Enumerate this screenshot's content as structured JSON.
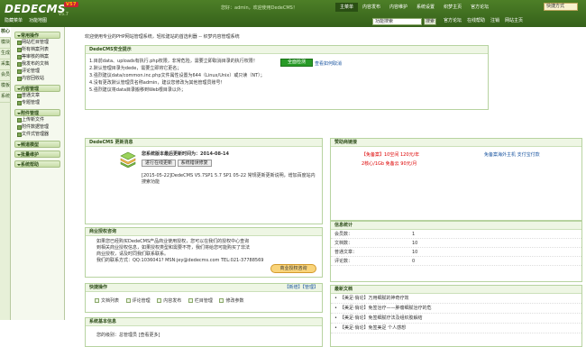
{
  "top": {
    "logo": "DEDECMS",
    "version_badge": "V57",
    "version_sub": "v5.7",
    "welcome": "您好：admin，欢迎使用DedeCMS！",
    "nav": [
      "主菜单",
      "内容发布",
      "内容维护",
      "系统设置",
      "织梦主页",
      "官方论坛"
    ],
    "active_nav": 0,
    "lang_label": "快捷方式"
  },
  "subbar": {
    "hide_label": "隐藏菜单",
    "func_label": "功能地图"
  },
  "search": {
    "value": "功能搜索",
    "button": "搜索"
  },
  "quick": [
    "官方论坛",
    "在线帮助",
    "注销",
    "网站主页"
  ],
  "sidetabs": [
    "核心",
    "模块",
    "生成",
    "采集",
    "会员",
    "模板",
    "系统"
  ],
  "menu": [
    {
      "title": "常用操作",
      "items": [
        "网站栏目管理",
        "所有档案列表",
        "等审核的档案",
        "我发布的文档",
        "评论管理",
        "内容回收站"
      ]
    },
    {
      "title": "内容管理",
      "items": [
        "普通文章",
        "专题管理"
      ]
    },
    {
      "title": "附件管理",
      "items": [
        "上传新文件",
        "附件数据管理",
        "文件式管理器"
      ]
    },
    {
      "title": "频道模型",
      "items": []
    },
    {
      "title": "批量维护",
      "items": []
    },
    {
      "title": "系统帮助",
      "items": []
    }
  ],
  "main": {
    "crumb": "欢迎使用专业的PHP网站管理系统，轻松建站的首选利器 -- 织梦内容管理系统",
    "security": {
      "title": "DedeCMS安全提示",
      "lines": [
        "1.目前data、uploads有执行.php权限，非常危险，需要立即取消目录的执行权限！",
        "2.默认管理目录为dede，需要立即将它更名；",
        "3.强烈建议data/common.inc.php文件属性设置为644（Linux/Unix）或只读（NT）；",
        "4.没有更改默认管理员名称admin，建议您修改为其他管理员账号！",
        "5.强烈建议将data目录搬移到Web根目录以外；"
      ],
      "check_button": "全面检测",
      "check_link": "查看如何取消"
    },
    "update": {
      "title": "DedeCMS 更新消息",
      "text": "您系统版本最后更新时间为：2014-08-14",
      "btn1": "进行在线更新",
      "btn2": "系统错误修复",
      "note": "[2015-05-22]DedeCMS V5.7SP1 5.7 SP1 05-22 常规更新更新说明，增加百度站内搜索功能"
    },
    "business": {
      "title": "商业授权咨询",
      "text": "如果您已经购买DedeCMS产品商业使用授权，您可以在我们的授权中心查询到相关商业授权信息，如果授权类型和需要不符，我们将给您可能购买了非法商业授权，请及时同我们联系联系。",
      "contact": "我们的联系方式：QQ:1036041? MSN:jey@dedecms.com TEL:021-37788569",
      "button": "商业授权咨询"
    },
    "quickops": {
      "title": "快捷操作",
      "right": "【新增】【管理】",
      "items": [
        "文档列表",
        "评论管理",
        "内容发布",
        "栏目管理",
        "修改参数"
      ]
    },
    "sysinfo": {
      "title": "系统基本信息",
      "text": "您的级别：总管理员 [查看更多]"
    },
    "sponsor": {
      "title": "赞助商链接",
      "l1a": "【免备案】10空间 120元/年",
      "l1b": "免备案海外主机 支付宝付款",
      "l2": "2核心/1Gb 免备云 90元/月"
    },
    "stats": {
      "title": "信息统计",
      "rows": [
        [
          "会员数：",
          "1"
        ],
        [
          "文档数：",
          "10"
        ],
        [
          "普通文章：",
          "10"
        ],
        [
          "评论数：",
          "0"
        ]
      ]
    },
    "news": {
      "title": "最新文档",
      "items": [
        "【美足·俏论】万用细腻的神奇疗效",
        "【美足·俏论】免签治疗——肿瘤细腻治疗的危",
        "【美足·俏论】免签细腻疗法及组织胶解结",
        "【美足·俏论】免签美足 个人感想"
      ]
    }
  }
}
